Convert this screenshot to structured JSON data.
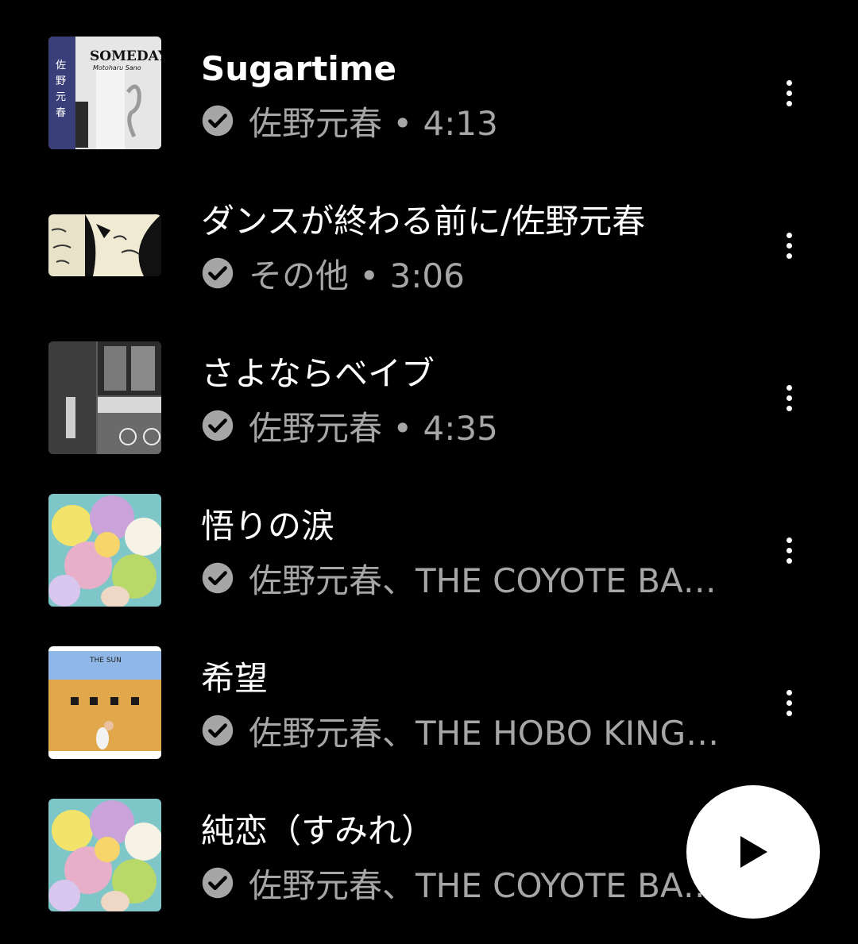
{
  "tracks": [
    {
      "title": "Sugartime",
      "subtitle": "佐野元春 • 4:13",
      "downloaded_icon": "check-circle-icon",
      "menu_icon": "more-vert-icon"
    },
    {
      "title": "ダンスが終わる前に/佐野元春",
      "subtitle": "その他 • 3:06",
      "downloaded_icon": "check-circle-icon",
      "menu_icon": "more-vert-icon"
    },
    {
      "title": "さよならベイブ",
      "subtitle": "佐野元春 • 4:35",
      "downloaded_icon": "check-circle-icon",
      "menu_icon": "more-vert-icon"
    },
    {
      "title": "悟りの涙",
      "subtitle": "佐野元春、THE COYOTE BAND",
      "downloaded_icon": "check-circle-icon",
      "menu_icon": "more-vert-icon"
    },
    {
      "title": "希望",
      "subtitle": "佐野元春、THE HOBO KING BAND",
      "downloaded_icon": "check-circle-icon",
      "menu_icon": "more-vert-icon"
    },
    {
      "title": "純恋（すみれ）",
      "subtitle": "佐野元春、THE COYOTE BAND",
      "downloaded_icon": "check-circle-icon",
      "menu_icon": "more-vert-icon"
    }
  ],
  "album_art_text": {
    "someday_title": "SOMEDAY",
    "someday_artist": "Motoharu Sano",
    "the_sun_title": "THE SUN"
  },
  "play_button": {
    "icon": "play-icon"
  },
  "colors": {
    "background": "#000000",
    "title_text": "#ffffff",
    "subtitle_text": "#a6a6a6",
    "fab_background": "#ffffff",
    "fab_icon": "#000000"
  }
}
